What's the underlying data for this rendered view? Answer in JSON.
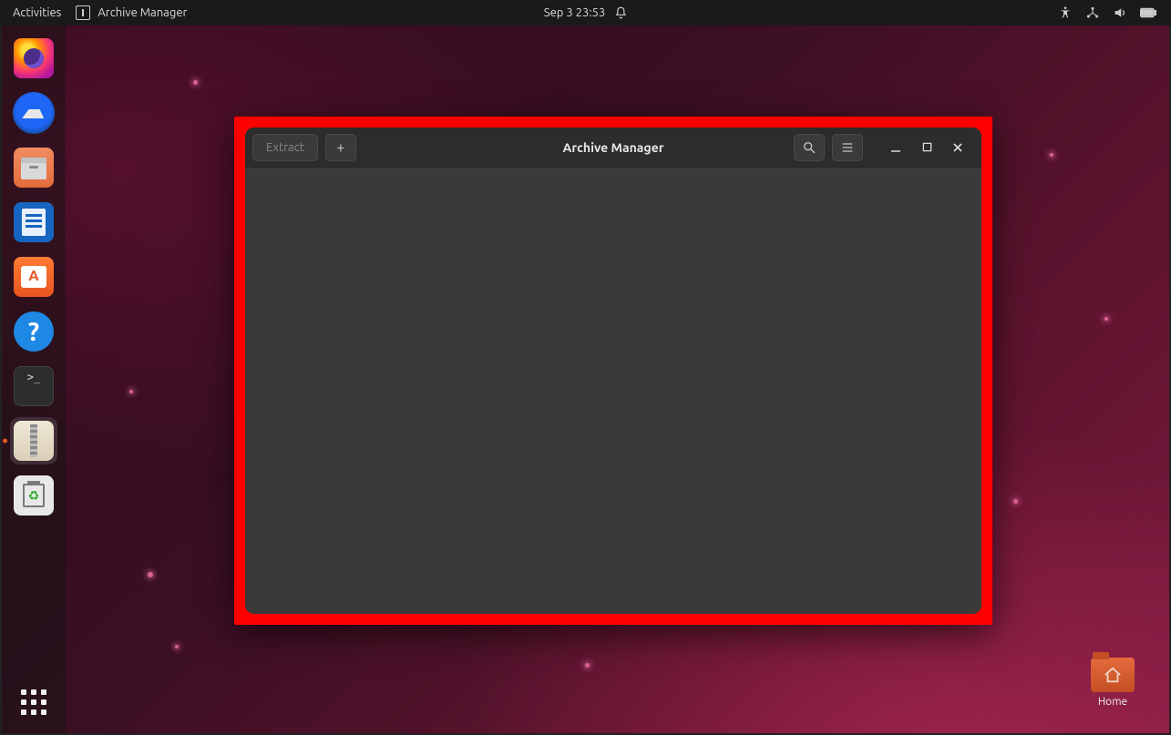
{
  "topbar": {
    "activities": "Activities",
    "app_name": "Archive Manager",
    "datetime": "Sep 3  23:53"
  },
  "dock": {
    "items": [
      {
        "name": "firefox"
      },
      {
        "name": "thunderbird"
      },
      {
        "name": "files"
      },
      {
        "name": "libreoffice-writer"
      },
      {
        "name": "ubuntu-software"
      },
      {
        "name": "help"
      },
      {
        "name": "terminal"
      },
      {
        "name": "archive-manager"
      },
      {
        "name": "trash"
      }
    ]
  },
  "desktop": {
    "home_label": "Home"
  },
  "window": {
    "title": "Archive Manager",
    "extract_label": "Extract",
    "add_label": "+"
  }
}
